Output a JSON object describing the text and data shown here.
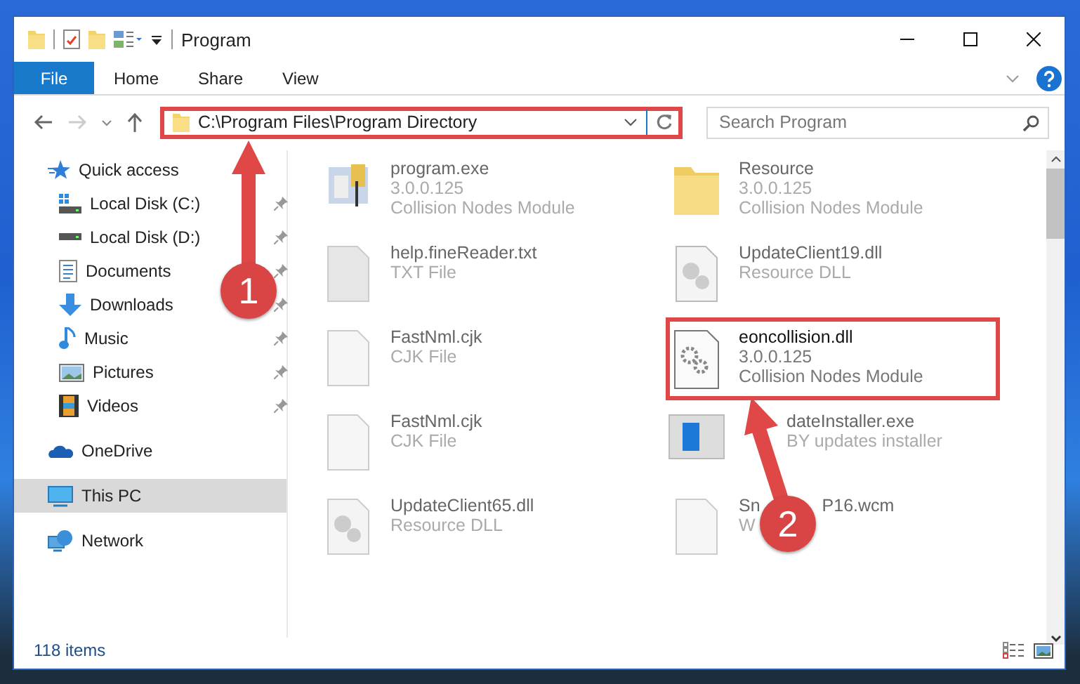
{
  "window": {
    "title": "Program"
  },
  "ribbon_tabs": [
    {
      "label": "File",
      "kind": "file"
    },
    {
      "label": "Home",
      "kind": "tab"
    },
    {
      "label": "Share",
      "kind": "tab"
    },
    {
      "label": "View",
      "kind": "tab"
    }
  ],
  "address_bar": {
    "path": "C:\\Program Files\\Program Directory",
    "highlighted": true
  },
  "search": {
    "placeholder": "Search Program"
  },
  "sidebar": {
    "items": [
      {
        "label": "Quick access",
        "selected": false,
        "children": [
          {
            "label": "Local Disk (C:)",
            "pinned": true
          },
          {
            "label": "Local Disk (D:)",
            "pinned": true
          },
          {
            "label": "Documents",
            "pinned": true
          },
          {
            "label": "Downloads",
            "pinned": true
          },
          {
            "label": "Music",
            "pinned": true
          },
          {
            "label": "Pictures",
            "pinned": true
          },
          {
            "label": "Videos",
            "pinned": true
          }
        ]
      },
      {
        "label": "OneDrive",
        "selected": false
      },
      {
        "label": "This PC",
        "selected": true
      },
      {
        "label": "Network",
        "selected": false
      }
    ]
  },
  "files": [
    {
      "lines": [
        "program.exe",
        "3.0.0.125",
        "Collision Nodes Module"
      ],
      "highlighted": false
    },
    {
      "lines": [
        "Resource",
        "3.0.0.125",
        "Collision Nodes Module"
      ],
      "highlighted": false
    },
    {
      "lines": [
        "help.fineReader.txt",
        "TXT File"
      ],
      "highlighted": false
    },
    {
      "lines": [
        "UpdateClient19.dll",
        "Resource DLL"
      ],
      "highlighted": false
    },
    {
      "lines": [
        "FastNml.cjk",
        "CJK File"
      ],
      "highlighted": false
    },
    {
      "lines": [
        "eoncollision.dll",
        "3.0.0.125",
        "Collision Nodes Module"
      ],
      "highlighted": true
    },
    {
      "lines": [
        "FastNml.cjk",
        "CJK File"
      ],
      "highlighted": false
    },
    {
      "lines": [
        "dateInstaller.exe",
        "BY updates installer"
      ],
      "highlighted": false,
      "covered_left": true
    },
    {
      "lines": [
        "UpdateClient65.dll",
        "Resource DLL"
      ],
      "highlighted": false
    },
    {
      "lines": [
        "Sn",
        "W"
      ],
      "name_suffix": "P16.wcm",
      "highlighted": false
    }
  ],
  "status_bar": {
    "item_count": "118 items"
  },
  "annotations": [
    {
      "label": "1"
    },
    {
      "label": "2"
    }
  ]
}
